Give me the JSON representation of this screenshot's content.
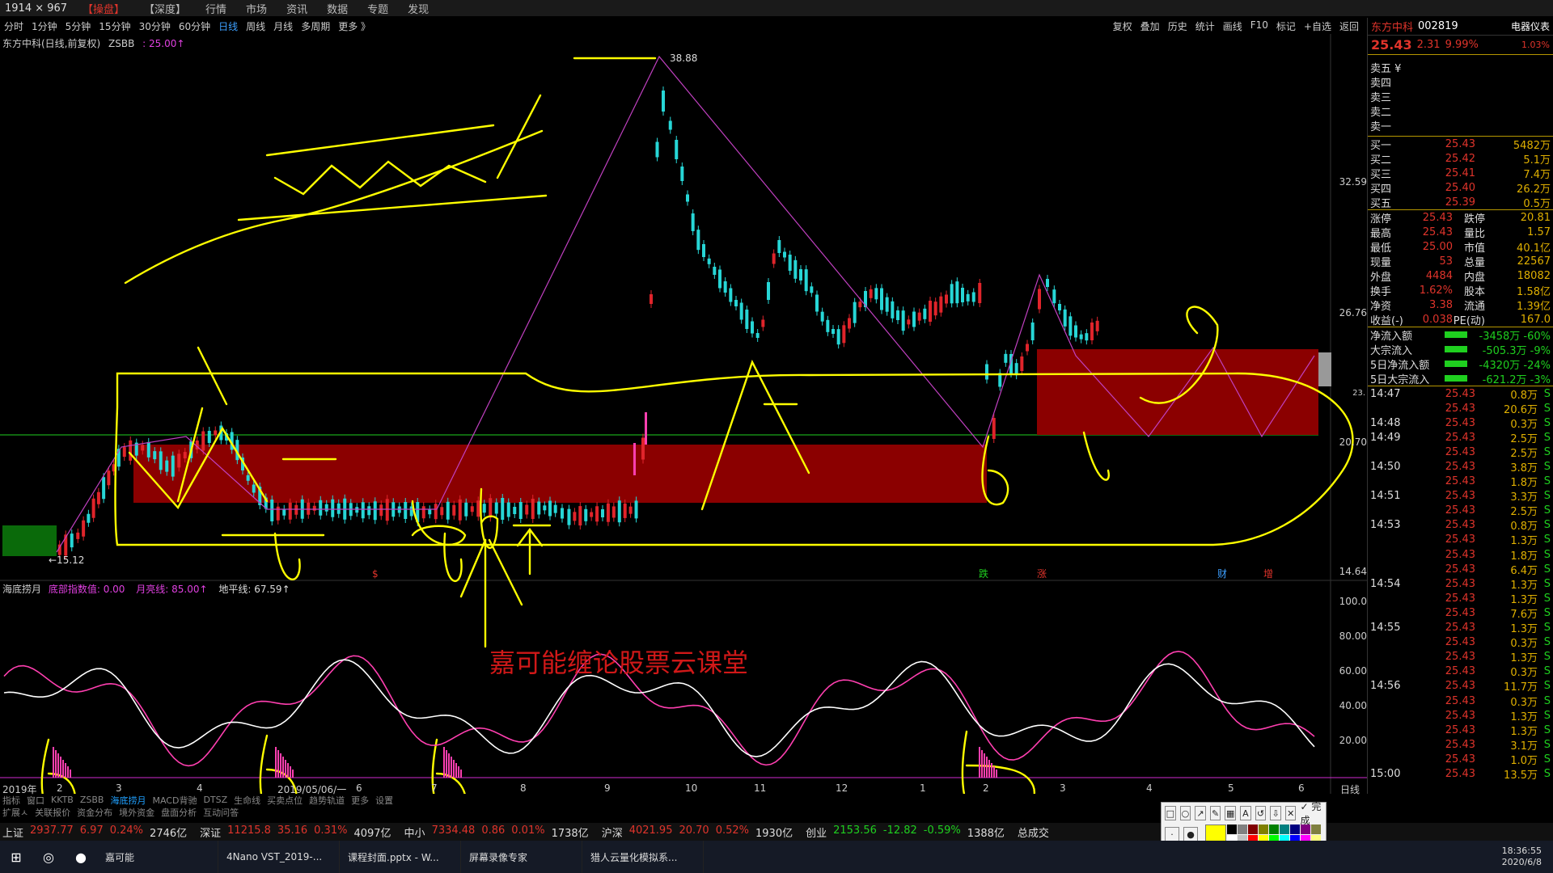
{
  "window": {
    "size_label": "1914 × 967"
  },
  "top_menu": [
    "【操盘】",
    "【深度】",
    "行情",
    "市场",
    "资讯",
    "数据",
    "专题",
    "发现"
  ],
  "periods": [
    "分时",
    "1分钟",
    "5分钟",
    "15分钟",
    "30分钟",
    "60分钟",
    "日线",
    "周线",
    "月线",
    "多周期",
    "更多 》"
  ],
  "active_period": "日线",
  "chart_tools": [
    "复权",
    "叠加",
    "历史",
    "统计",
    "画线",
    "F10",
    "标记",
    "+自选",
    "返回"
  ],
  "stock_header": {
    "name": "东方中科(日线,前复权)",
    "indicator": "ZSBB",
    "indicator_value": ": 25.00↑"
  },
  "price_axis": [
    "32.59",
    "26.76",
    "20.70",
    "14.64"
  ],
  "price_labels": {
    "high": "38.88",
    "low": "←15.12",
    "right_cur": "23."
  },
  "event_markers": [
    "$",
    "跌",
    "涨",
    "财",
    "增"
  ],
  "sub_header": {
    "name": "海底捞月",
    "a": "底部指数值: 0.00",
    "b": "月亮线: 85.00↑",
    "c": "地平线: 67.59↑"
  },
  "osc_axis": [
    "100.0",
    "80.00",
    "60.00",
    "40.00",
    "20.00"
  ],
  "x_axis": [
    "2019年",
    "2",
    "3",
    "4",
    "2019/05/06/一",
    "6",
    "7",
    "8",
    "9",
    "10",
    "11",
    "12",
    "1",
    "2",
    "3",
    "4",
    "5",
    "6",
    "日线"
  ],
  "watermark": "嘉可能缠论股票云课堂",
  "panel": {
    "name": "东方中科",
    "code": "002819",
    "industry": "电器仪表",
    "price": "25.43",
    "change": "2.31",
    "pct": "9.99%",
    "extra": "1.03%",
    "asks": [
      "卖五 ¥",
      "卖四",
      "卖三",
      "卖二",
      "卖一"
    ],
    "bids": [
      {
        "l": "买一",
        "p": "25.43",
        "v": "5482万"
      },
      {
        "l": "买二",
        "p": "25.42",
        "v": "5.1万"
      },
      {
        "l": "买三",
        "p": "25.41",
        "v": "7.4万"
      },
      {
        "l": "买四",
        "p": "25.40",
        "v": "26.2万"
      },
      {
        "l": "买五",
        "p": "25.39",
        "v": "0.5万"
      }
    ],
    "stats": [
      {
        "l": "涨停",
        "m": "25.43",
        "k": "跌停",
        "r": "20.81"
      },
      {
        "l": "最高",
        "m": "25.43",
        "k": "量比",
        "r": "1.57"
      },
      {
        "l": "最低",
        "m": "25.00",
        "k": "市值",
        "r": "40.1亿"
      },
      {
        "l": "现量",
        "m": "53",
        "k": "总量",
        "r": "22567"
      },
      {
        "l": "外盘",
        "m": "4484",
        "k": "内盘",
        "r": "18082"
      },
      {
        "l": "换手",
        "m": "1.62%",
        "k": "股本",
        "r": "1.58亿"
      },
      {
        "l": "净资",
        "m": "3.38",
        "k": "流通",
        "r": "1.39亿"
      },
      {
        "l": "收益(-)",
        "m": "0.038",
        "k": "PE(动)",
        "r": "167.0"
      }
    ],
    "flows": [
      {
        "l": "净流入额",
        "v": "-3458万 -60%"
      },
      {
        "l": "大宗流入",
        "v": "-505.3万 -9%"
      },
      {
        "l": "5日净流入额",
        "v": "-4320万 -24%"
      },
      {
        "l": "5日大宗流入",
        "v": "-621.2万 -3%"
      }
    ],
    "ticks": [
      {
        "t": "14:47",
        "p": "25.43",
        "v": "0.8万",
        "s": "S"
      },
      {
        "t": "",
        "p": "25.43",
        "v": "20.6万",
        "s": "S"
      },
      {
        "t": "14:48",
        "p": "25.43",
        "v": "0.3万",
        "s": "S"
      },
      {
        "t": "14:49",
        "p": "25.43",
        "v": "2.5万",
        "s": "S"
      },
      {
        "t": "",
        "p": "25.43",
        "v": "2.5万",
        "s": "S"
      },
      {
        "t": "14:50",
        "p": "25.43",
        "v": "3.8万",
        "s": "S"
      },
      {
        "t": "",
        "p": "25.43",
        "v": "1.8万",
        "s": "S"
      },
      {
        "t": "14:51",
        "p": "25.43",
        "v": "3.3万",
        "s": "S"
      },
      {
        "t": "",
        "p": "25.43",
        "v": "2.5万",
        "s": "S"
      },
      {
        "t": "14:53",
        "p": "25.43",
        "v": "0.8万",
        "s": "S"
      },
      {
        "t": "",
        "p": "25.43",
        "v": "1.3万",
        "s": "S"
      },
      {
        "t": "",
        "p": "25.43",
        "v": "1.8万",
        "s": "S"
      },
      {
        "t": "",
        "p": "25.43",
        "v": "6.4万",
        "s": "S"
      },
      {
        "t": "14:54",
        "p": "25.43",
        "v": "1.3万",
        "s": "S"
      },
      {
        "t": "",
        "p": "25.43",
        "v": "1.3万",
        "s": "S"
      },
      {
        "t": "",
        "p": "25.43",
        "v": "7.6万",
        "s": "S"
      },
      {
        "t": "14:55",
        "p": "25.43",
        "v": "1.3万",
        "s": "S"
      },
      {
        "t": "",
        "p": "25.43",
        "v": "0.3万",
        "s": "S"
      },
      {
        "t": "",
        "p": "25.43",
        "v": "1.3万",
        "s": "S"
      },
      {
        "t": "",
        "p": "25.43",
        "v": "0.3万",
        "s": "S"
      },
      {
        "t": "14:56",
        "p": "25.43",
        "v": "11.7万",
        "s": "S"
      },
      {
        "t": "",
        "p": "25.43",
        "v": "0.3万",
        "s": "S"
      },
      {
        "t": "",
        "p": "25.43",
        "v": "1.3万",
        "s": "S"
      },
      {
        "t": "",
        "p": "25.43",
        "v": "1.3万",
        "s": "S"
      },
      {
        "t": "",
        "p": "25.43",
        "v": "3.1万",
        "s": "S"
      },
      {
        "t": "",
        "p": "25.43",
        "v": "1.0万",
        "s": "S"
      },
      {
        "t": "15:00",
        "p": "25.43",
        "v": "13.5万",
        "s": "S"
      }
    ]
  },
  "bottom_tabs1": [
    "指标",
    "窗口",
    "KKTB",
    "ZSBB",
    "海底捞月",
    "MACD背驰",
    "DTSZ",
    "生命线",
    "买卖点位",
    "趋势轨道",
    "更多",
    "设置"
  ],
  "bottom_tabs2": [
    "扩展ㅅ",
    "关联报价",
    "资金分布",
    "境外资金",
    "盘面分析",
    "互动问答"
  ],
  "indices": [
    {
      "n": "上证",
      "v": "2937.77",
      "c": "6.97",
      "p": "0.24%",
      "vol": "2746亿",
      "d": "up"
    },
    {
      "n": "深证",
      "v": "11215.8",
      "c": "35.16",
      "p": "0.31%",
      "vol": "4097亿",
      "d": "up"
    },
    {
      "n": "中小",
      "v": "7334.48",
      "c": "0.86",
      "p": "0.01%",
      "vol": "1738亿",
      "d": "up"
    },
    {
      "n": "沪深",
      "v": "4021.95",
      "c": "20.70",
      "p": "0.52%",
      "vol": "1930亿",
      "d": "up"
    },
    {
      "n": "创业",
      "v": "2153.56",
      "c": "-12.82",
      "p": "-0.59%",
      "vol": "1388亿",
      "d": "dn"
    }
  ],
  "index_tail": "总成交",
  "taskbar": [
    {
      "icon": "⊞",
      "label": ""
    },
    {
      "icon": "◎",
      "label": ""
    },
    {
      "icon": "●",
      "label": ""
    },
    {
      "icon": "",
      "label": "嘉可能"
    },
    {
      "icon": "",
      "label": "4Nano VST_2019-..."
    },
    {
      "icon": "",
      "label": "课程封面.pptx - W..."
    },
    {
      "icon": "",
      "label": "屏幕录像专家"
    },
    {
      "icon": "",
      "label": "猎人云量化模拟系..."
    }
  ],
  "clock": {
    "time": "18:36:55",
    "date": "2020/6/8"
  },
  "drawtools": {
    "done_label": "完成"
  },
  "colors": {
    "up": "#e0342b",
    "down": "#1fd01f",
    "yellow_ink": "#ffff00",
    "box": "#8b0000",
    "magenta": "#e040e0",
    "accent_blue": "#3da0ff"
  }
}
